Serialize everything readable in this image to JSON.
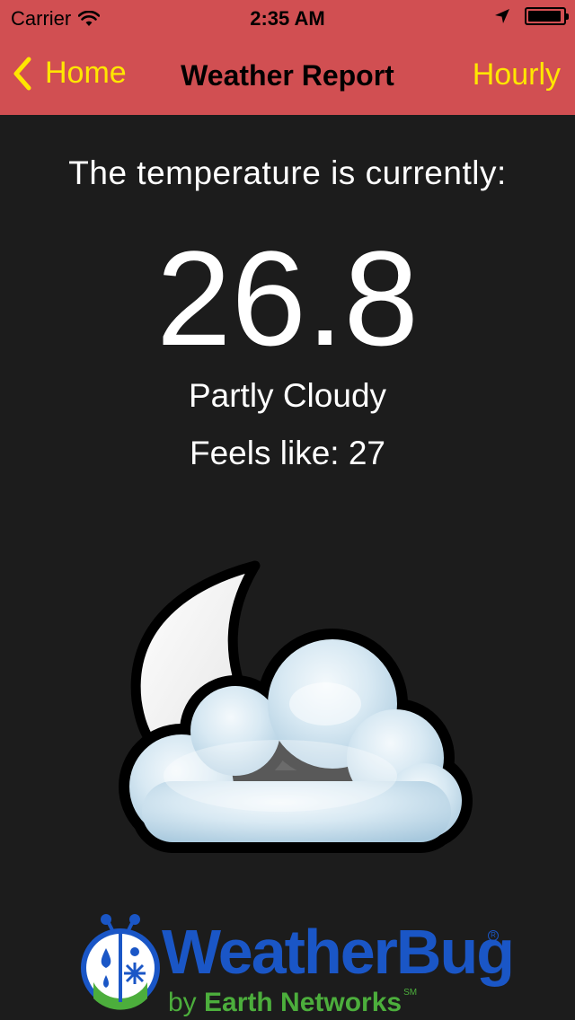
{
  "status_bar": {
    "carrier": "Carrier",
    "time": "2:35 AM"
  },
  "nav": {
    "back_label": "Home",
    "title": "Weather Report",
    "right_label": "Hourly"
  },
  "weather": {
    "intro": "The temperature is currently:",
    "temperature": "26.8",
    "condition": "Partly Cloudy",
    "feels_like": "Feels like: 27",
    "icon": "partly-cloudy-night"
  },
  "branding": {
    "name": "WeatherBug",
    "by": "by",
    "company": "Earth Networks",
    "sm": "SM"
  },
  "colors": {
    "nav_background": "#d14f52",
    "nav_accent": "#ffe600",
    "content_background": "#1c1c1c",
    "brand_blue": "#1a56c6",
    "brand_green": "#4cae3c"
  }
}
